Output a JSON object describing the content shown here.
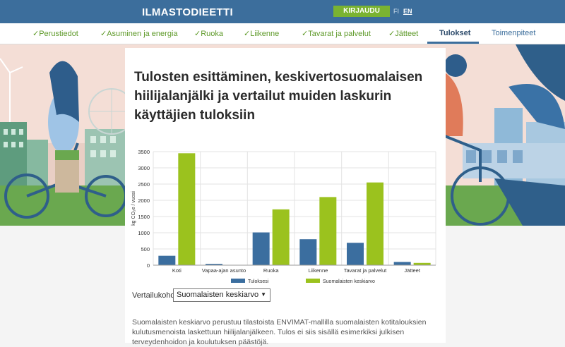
{
  "header": {
    "brand": "ILMASTODIEETTI",
    "login_label": "KIRJAUDU",
    "lang_fi": "FI",
    "lang_en": "EN"
  },
  "nav": {
    "items": [
      {
        "label": "Perustiedot",
        "check": "✓"
      },
      {
        "label": "Asuminen ja energia",
        "check": "✓"
      },
      {
        "label": "Ruoka",
        "check": "✓"
      },
      {
        "label": "Liikenne",
        "check": "✓"
      },
      {
        "label": "Tavarat ja palvelut",
        "check": "✓"
      },
      {
        "label": "Jätteet",
        "check": "✓"
      },
      {
        "label": "Tulokset",
        "check": ""
      },
      {
        "label": "Toimenpiteet",
        "check": ""
      }
    ],
    "active_index": 6
  },
  "content": {
    "title": "Tulosten esittäminen, keskivertosuomalaisen hiilijalanjälki ja vertailut muiden laskurin käyttäjien tuloksiin",
    "compare_label": "Vertailukohde",
    "compare_selected": "Suomalaisten keskiarvo",
    "description": "Suomalaisten keskiarvo perustuu tilastoista ENVIMAT-mallilla suomalaisten kotitalouksien kulutusmenoista laskettuun hiilijalanjälkeen. Tulos ei siis sisällä esimerkiksi julkisen terveydenhoidon ja koulutuksen päästöjä."
  },
  "chart_data": {
    "type": "bar",
    "categories": [
      "Koti",
      "Vapaa-ajan asunto",
      "Ruoka",
      "Liikenne",
      "Tavarat ja palvelut",
      "Jätteet"
    ],
    "series": [
      {
        "name": "Tuloksesi",
        "color": "#3b6e9f",
        "values": [
          290,
          40,
          1010,
          800,
          690,
          100
        ]
      },
      {
        "name": "Suomalaisten keskiarvo",
        "color": "#9bc21e",
        "values": [
          3450,
          0,
          1720,
          2100,
          2550,
          70
        ]
      }
    ],
    "ylabel": "kg CO₂e / vuosi",
    "ylim": [
      0,
      3500
    ],
    "yticks": [
      0,
      500,
      1000,
      1500,
      2000,
      2500,
      3000,
      3500
    ],
    "grid": true,
    "legend": "bottom-center"
  }
}
